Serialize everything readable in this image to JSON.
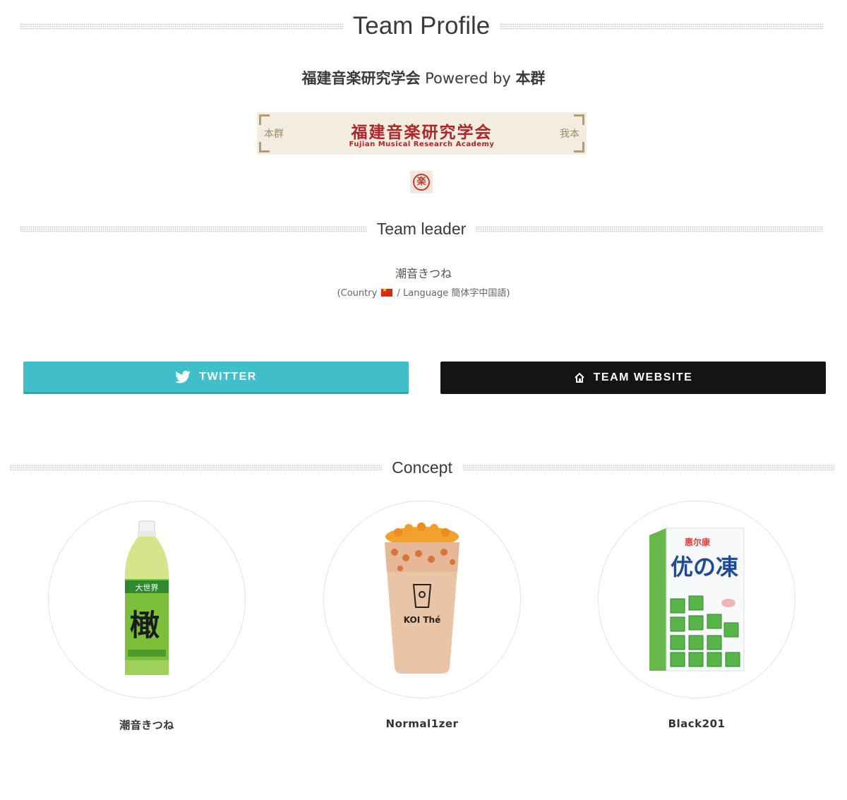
{
  "headings": {
    "profile": "Team Profile",
    "leader": "Team leader",
    "concept": "Concept"
  },
  "subtitle": {
    "team": "福建音楽研究学会",
    "powered": " Powered by ",
    "by": "本群"
  },
  "banner": {
    "main": "福建音楽研究学会",
    "sub": "Fujian Musical Research Academy",
    "left_mark": "本群",
    "right_mark": "我本"
  },
  "seal": {
    "glyph": "楽"
  },
  "leader": {
    "name": "潮音きつね",
    "meta_prefix": "(Country ",
    "meta_suffix": " / Language 簡体字中国語)",
    "flag": "china-flag-icon"
  },
  "buttons": {
    "twitter": "TWITTER",
    "website": "TEAM WEBSITE"
  },
  "members": [
    {
      "name": "潮音きつね",
      "image": "green-tea-bottle"
    },
    {
      "name": "Normal1zer",
      "image": "koi-milk-tea-cup"
    },
    {
      "name": "Black201",
      "image": "jelly-drink-carton"
    }
  ],
  "colors": {
    "twitter": "#40bfca",
    "website": "#141414",
    "banner_text": "#b0242a"
  }
}
